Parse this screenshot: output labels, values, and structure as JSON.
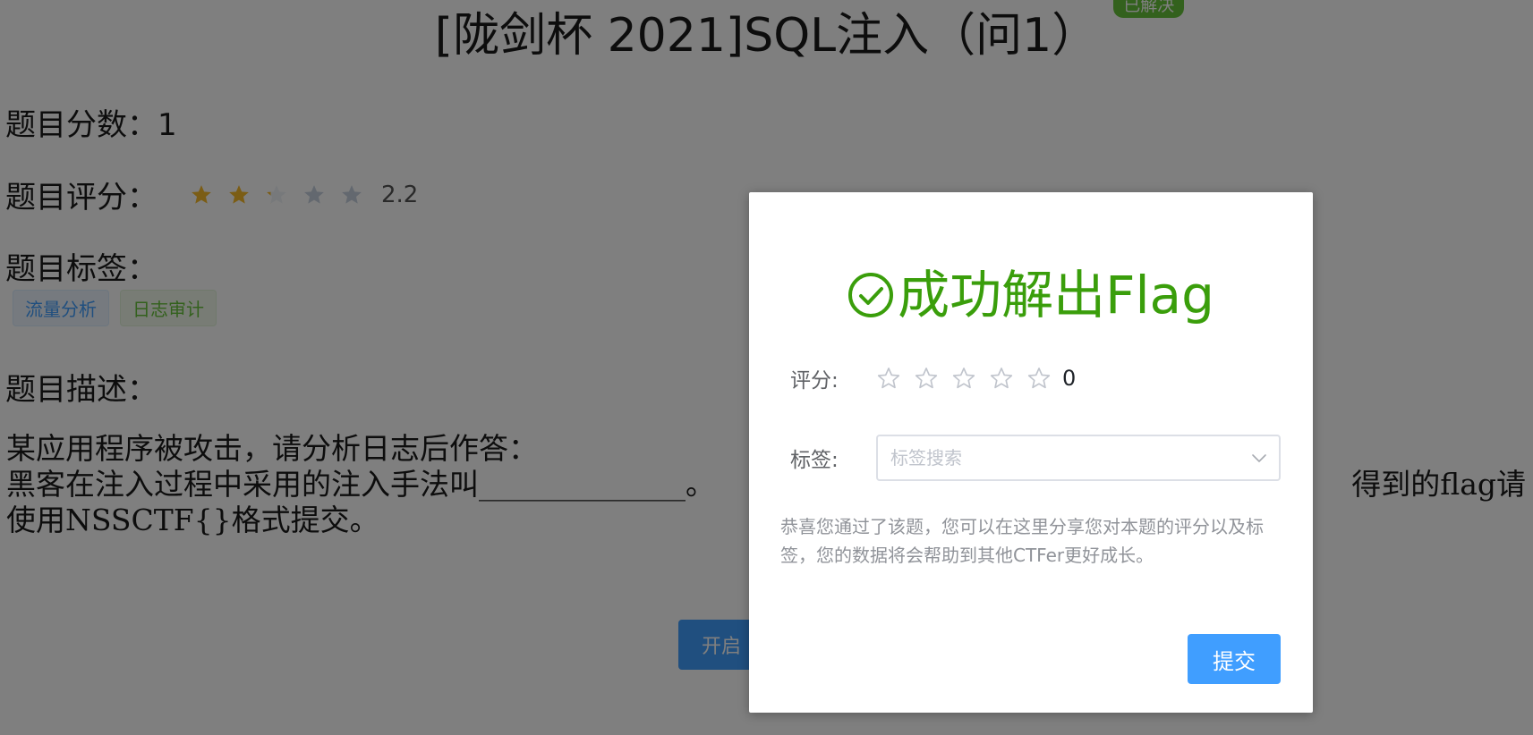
{
  "challenge": {
    "title": "[陇剑杯 2021]SQL注入（问1）",
    "solved_badge": "已解决",
    "score_label": "题目分数：",
    "score_value": "1",
    "rating_label": "题目评分：",
    "rating_value": "2.2",
    "rating_level": 2.2,
    "rating_max": 5,
    "tags_label": "题目标签：",
    "tags": [
      {
        "label": "流量分析",
        "color": "#409eff"
      },
      {
        "label": "日志审计",
        "color": "#67c23a"
      }
    ],
    "description_label": "题目描述：",
    "description_lines": [
      "某应用程序被攻击，请分析日志后作答：",
      "黑客在注入过程中采用的注入手法叫______________。",
      "使用NSSCTF{}格式提交。"
    ],
    "description_right": "得到的flag请",
    "start_button": "开启"
  },
  "modal": {
    "title": "成功解出Flag",
    "title_color": "#3a9e0b",
    "rating_label": "评分:",
    "rating_value": "0",
    "tags_label": "标签:",
    "tags_placeholder": "标签搜索",
    "note": "恭喜您通过了该题，您可以在这里分享您对本题的评分以及标签，您的数据将会帮助到其他CTFer更好成长。",
    "submit_button": "提交"
  },
  "colors": {
    "accent": "#409eff",
    "success": "#67c23a",
    "star_filled": "#f7ba2a",
    "star_empty": "#c6d1de"
  }
}
